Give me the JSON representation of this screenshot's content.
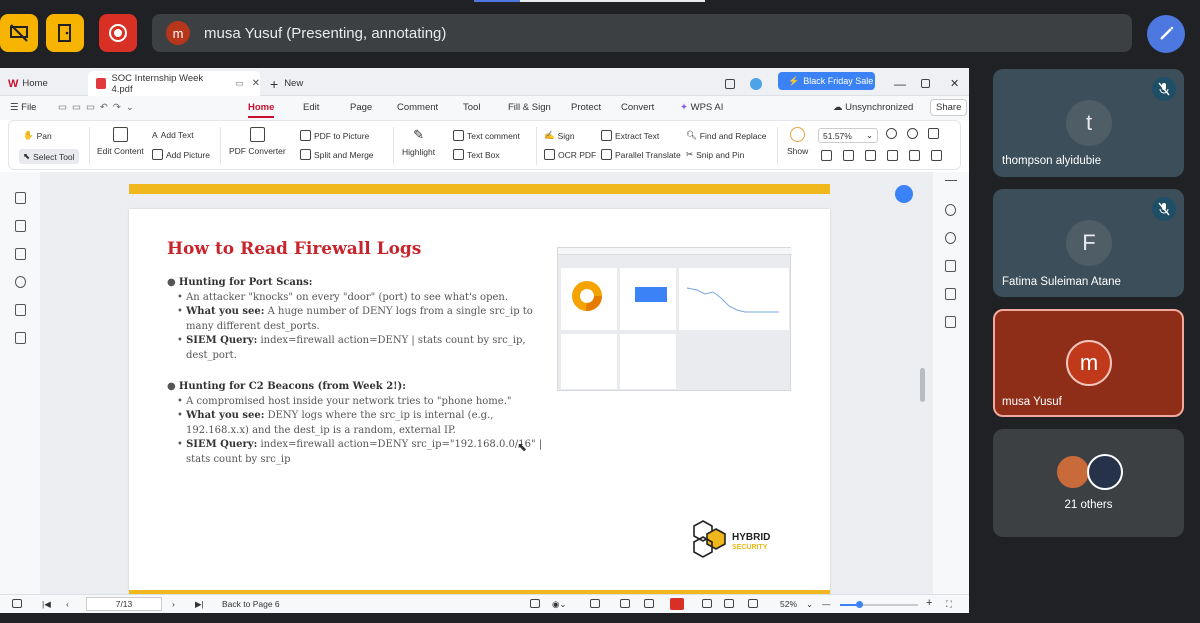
{
  "meet": {
    "presenter_initial": "m",
    "presenter_label": "musa Yusuf (Presenting, annotating)"
  },
  "app": {
    "tabs": [
      {
        "label": "Home"
      },
      {
        "label": "SOC Internship Week 4.pdf"
      },
      {
        "label": "New"
      }
    ],
    "promo": "Black Friday Sale",
    "menu": [
      "File",
      "Home",
      "Edit",
      "Page",
      "Comment",
      "Tool",
      "Fill & Sign",
      "Protect",
      "Convert",
      "WPS AI"
    ],
    "sync_status": "Unsynchronized",
    "share_label": "Share",
    "toolbar": {
      "pan": "Pan",
      "select_tool": "Select Tool",
      "edit_content": "Edit Content",
      "add_text": "Add Text",
      "add_picture": "Add Picture",
      "pdf_converter": "PDF Converter",
      "pdf_to_picture": "PDF to Picture",
      "split_merge": "Split and Merge",
      "highlight": "Highlight",
      "text_comment": "Text comment",
      "text_box": "Text Box",
      "sign": "Sign",
      "ocr_pdf": "OCR PDF",
      "extract_text": "Extract Text",
      "parallel_translate": "Parallel Translate",
      "find_replace": "Find and Replace",
      "snip_pin": "Snip and Pin",
      "show": "Show",
      "zoom": "51.57%"
    }
  },
  "document": {
    "title": "How to Read Firewall Logs",
    "section1_heading": "Hunting for Port Scans:",
    "s1_b1": "An attacker \"knocks\" on every \"door\" (port) to see what's open.",
    "s1_b2_label": "What you see:",
    "s1_b2_line1": " A huge number of DENY logs from a single src_ip to",
    "s1_b2_line2": "many different dest_ports.",
    "s1_b3_label": "SIEM Query:",
    "s1_b3_line1": " index=firewall action=DENY | stats count by src_ip,",
    "s1_b3_line2": "dest_port.",
    "section2_heading": "Hunting for C2 Beacons (from Week 2!):",
    "s2_b1": "A compromised host inside your network tries to \"phone home.\"",
    "s2_b2_label": "What you see:",
    "s2_b2_line1": " DENY logs where the src_ip is internal (e.g.,",
    "s2_b2_line2": "192.168.x.x) and the dest_ip is a random, external IP.",
    "s2_b3_label": "SIEM Query:",
    "s2_b3_line1": " index=firewall action=DENY src_ip=\"192.168.0.0/16\" |",
    "s2_b3_line2": "stats count by src_ip",
    "logo_text_1": "HYBRID",
    "logo_text_2": "SECURITY"
  },
  "status": {
    "page": "7/13",
    "back": "Back to Page 6",
    "zoom": "52%"
  },
  "participants": [
    {
      "initial": "t",
      "name": "thompson alyidubie",
      "muted": true
    },
    {
      "initial": "F",
      "name": "Fatima Suleiman Atane",
      "muted": true
    },
    {
      "initial": "m",
      "name": "musa Yusuf",
      "muted": false
    },
    {
      "name": "21 others"
    }
  ],
  "colors": {
    "meet_bg": "#202124",
    "accent_yellow": "#f0b81c",
    "record_red": "#d93025",
    "doc_red": "#c8242b",
    "active_tile": "#b5361b"
  }
}
